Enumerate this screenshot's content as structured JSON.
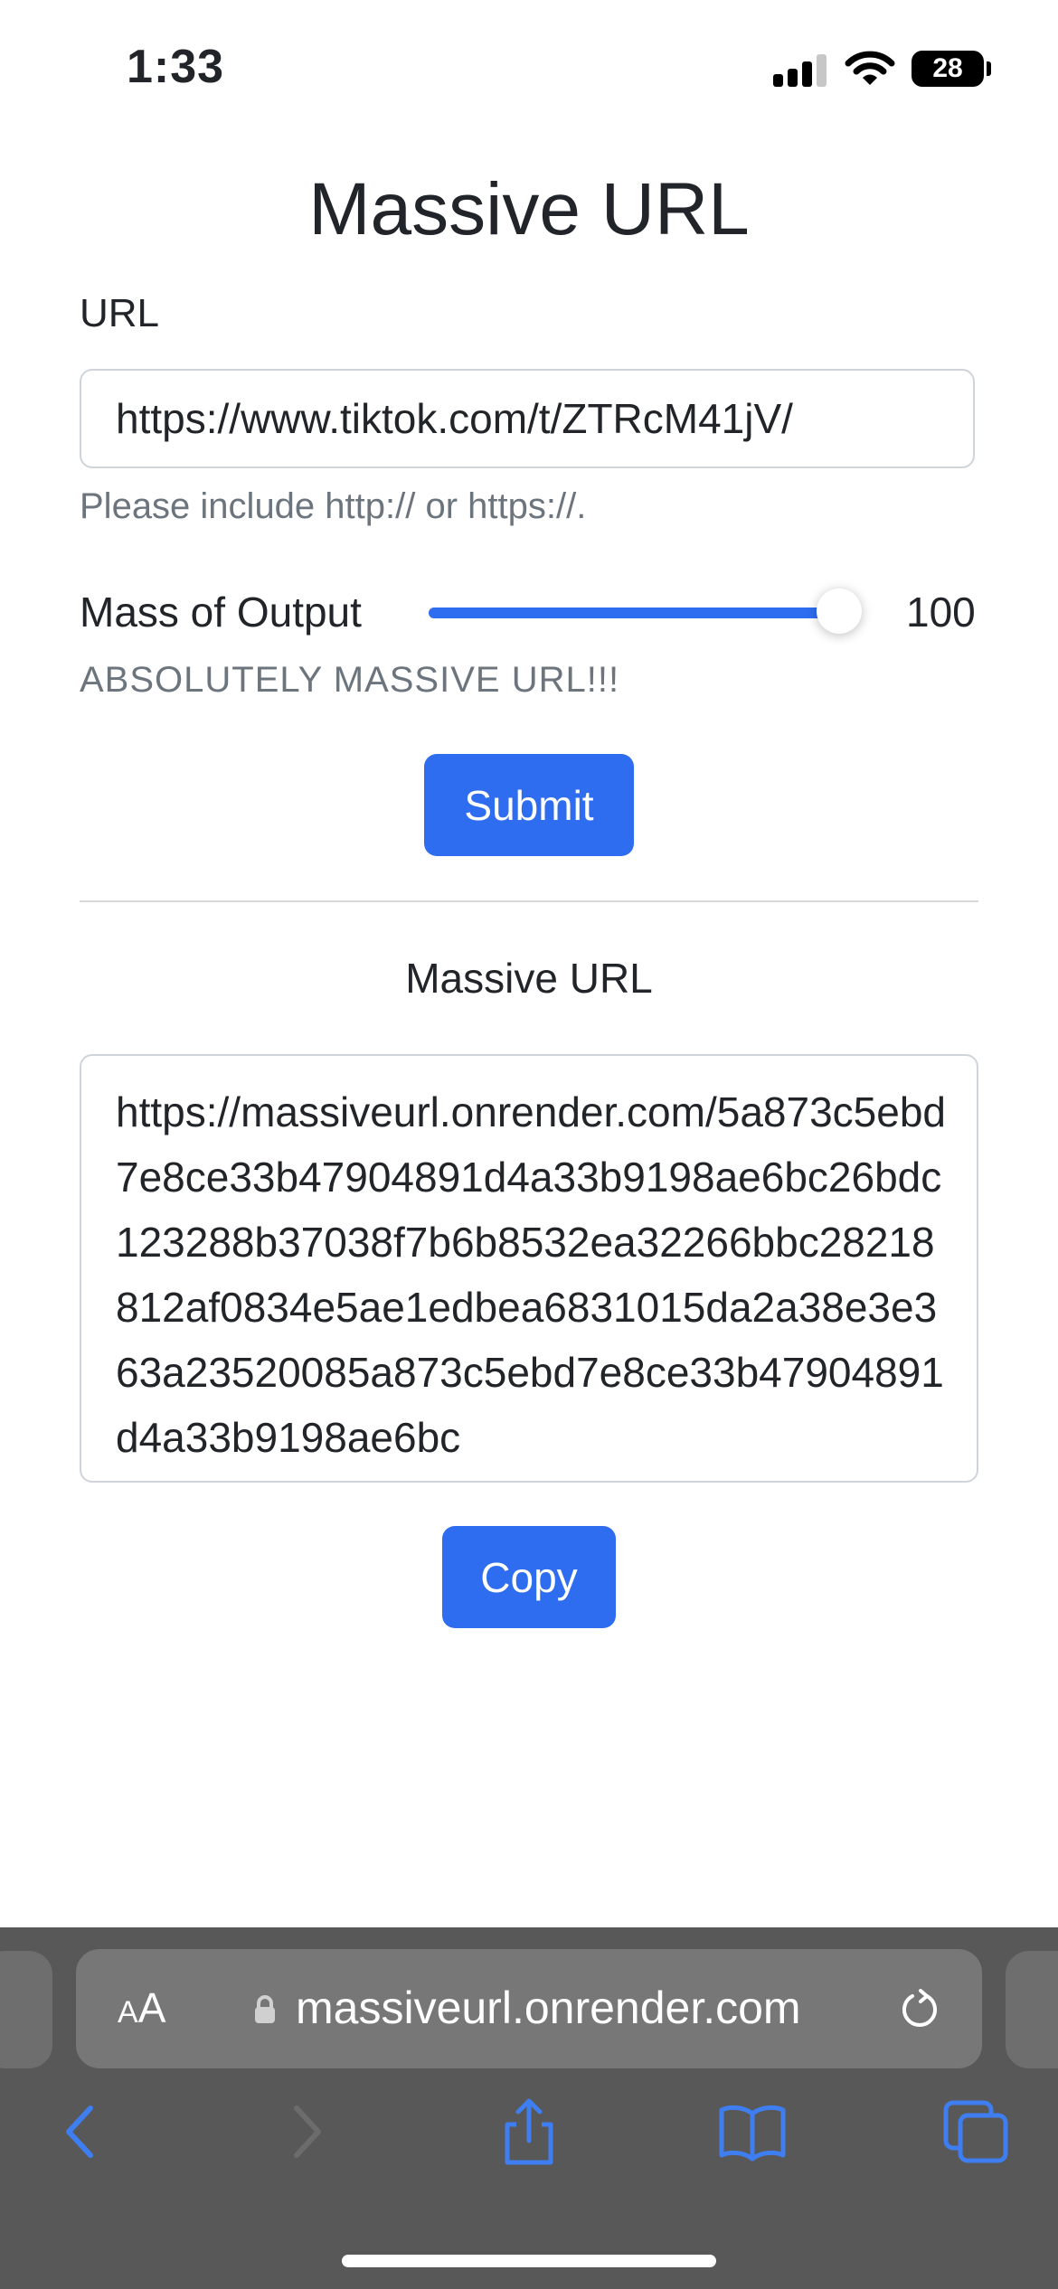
{
  "status_bar": {
    "time": "1:33",
    "battery": "28"
  },
  "main": {
    "title": "Massive URL",
    "url_label": "URL",
    "url_value": "https://www.tiktok.com/t/ZTRcM41jV/",
    "url_help": "Please include http:// or https://.",
    "mass_label": "Mass of Output",
    "mass_value": "100",
    "mass_slider_fraction": 1.0,
    "mass_description": "ABSOLUTELY MASSIVE URL!!!",
    "submit_label": "Submit",
    "result_title": "Massive URL",
    "result_text": "https://massiveurl.onrender.com/5a873c5ebd7e8ce33b47904891d4a33b9198ae6bc26bdc123288b37038f7b6b8532ea32266bbc28218812af0834e5ae1edbea6831015da2a38e3e363a23520085a873c5ebd7e8ce33b47904891d4a33b9198ae6bc",
    "copy_label": "Copy"
  },
  "browser": {
    "aa_label_small": "A",
    "aa_label_large": "A",
    "address": "massiveurl.onrender.com",
    "icons": [
      "lock-icon",
      "reload-icon",
      "back-icon",
      "forward-icon",
      "share-icon",
      "bookmarks-icon",
      "tabs-icon"
    ]
  },
  "colors": {
    "accent": "#2f6df0",
    "muted_text": "#6c757d",
    "browser_bar": "#585858"
  }
}
